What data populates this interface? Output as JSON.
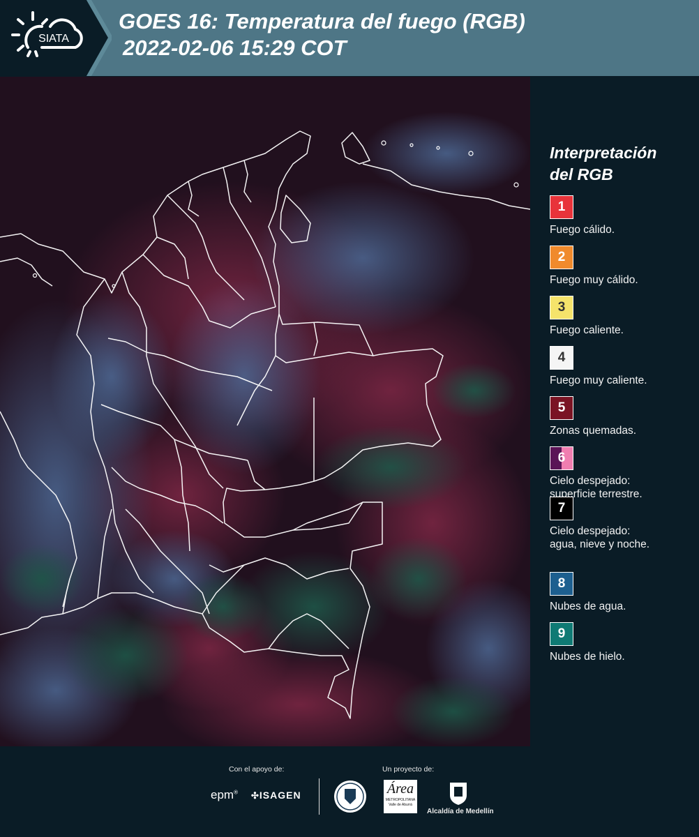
{
  "header": {
    "logo_text": "SIATA",
    "title_line1": "GOES 16: Temperatura del fuego (RGB)",
    "title_line2": "2022-02-06 15:29 COT"
  },
  "legend": {
    "title_line1": "Interpretación",
    "title_line2": "del RGB",
    "items": [
      {
        "num": "1",
        "color": "#e8333a",
        "text_color": "#ffffff",
        "desc1": "Fuego cálido.",
        "desc2": ""
      },
      {
        "num": "2",
        "color": "#f08a2c",
        "text_color": "#ffffff",
        "desc1": "Fuego muy cálido.",
        "desc2": ""
      },
      {
        "num": "3",
        "color": "#f5e36b",
        "text_color": "#333333",
        "desc1": "Fuego caliente.",
        "desc2": ""
      },
      {
        "num": "4",
        "color": "#f5f5f5",
        "text_color": "#333333",
        "desc1": "Fuego muy caliente.",
        "desc2": ""
      },
      {
        "num": "5",
        "color": "#7a1424",
        "text_color": "#ffffff",
        "desc1": "Zonas quemadas.",
        "desc2": ""
      },
      {
        "num": "6",
        "color": "#5a1456",
        "color2": "#f07eb0",
        "text_color": "#ffffff",
        "desc1": "Cielo despejado:",
        "desc2": "superficie terrestre."
      },
      {
        "num": "7",
        "color": "#000000",
        "text_color": "#ffffff",
        "desc1": "Cielo despejado:",
        "desc2": "agua, nieve y noche."
      },
      {
        "num": "8",
        "color": "#1d5f8f",
        "text_color": "#ffffff",
        "desc1": "Nubes de agua.",
        "desc2": ""
      },
      {
        "num": "9",
        "color": "#0f7a74",
        "text_color": "#ffffff",
        "desc1": "Nubes de hielo.",
        "desc2": ""
      }
    ]
  },
  "footer": {
    "support_label": "Con el apoyo de:",
    "project_label": "Un proyecto de:",
    "sponsor1": "epm",
    "sponsor2": "ISAGEN",
    "partner1": "Área",
    "partner1_sub": "METROPOLITANA",
    "partner1_sub2": "Valle de Aburrá",
    "partner2": "Alcaldía de Medellín"
  }
}
